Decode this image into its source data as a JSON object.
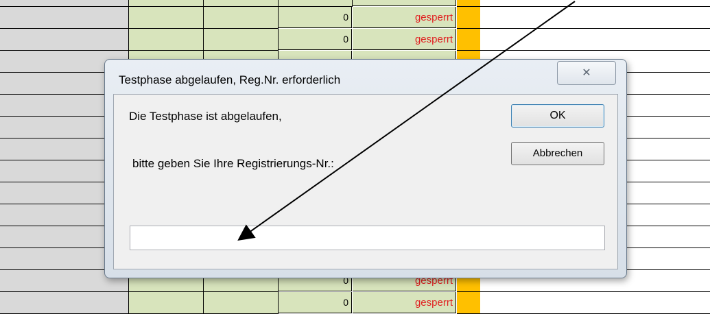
{
  "sheet": {
    "rows": [
      {
        "num": "0",
        "status": "gesperrt"
      },
      {
        "num": "0",
        "status": "gesperrt"
      },
      {
        "num": "",
        "status": ""
      },
      {
        "num": "",
        "status": ""
      },
      {
        "num": "",
        "status": ""
      },
      {
        "num": "",
        "status": ""
      },
      {
        "num": "",
        "status": ""
      },
      {
        "num": "",
        "status": ""
      },
      {
        "num": "",
        "status": ""
      },
      {
        "num": "",
        "status": ""
      },
      {
        "num": "",
        "status": ""
      },
      {
        "num": "",
        "status": ""
      },
      {
        "num": "0",
        "status": "gesperrt"
      },
      {
        "num": "0",
        "status": "gesperrt"
      }
    ]
  },
  "dialog": {
    "title": "Testphase abgelaufen, Reg.Nr. erforderlich",
    "close_glyph": "✕",
    "prompt_line1": "Die Testphase ist abgelaufen,",
    "prompt_line2": "bitte geben Sie Ihre Registrierungs-Nr.:",
    "ok_label": "OK",
    "cancel_label": "Abbrechen",
    "input_value": ""
  },
  "annotation": {
    "arrow_color": "#000000"
  }
}
